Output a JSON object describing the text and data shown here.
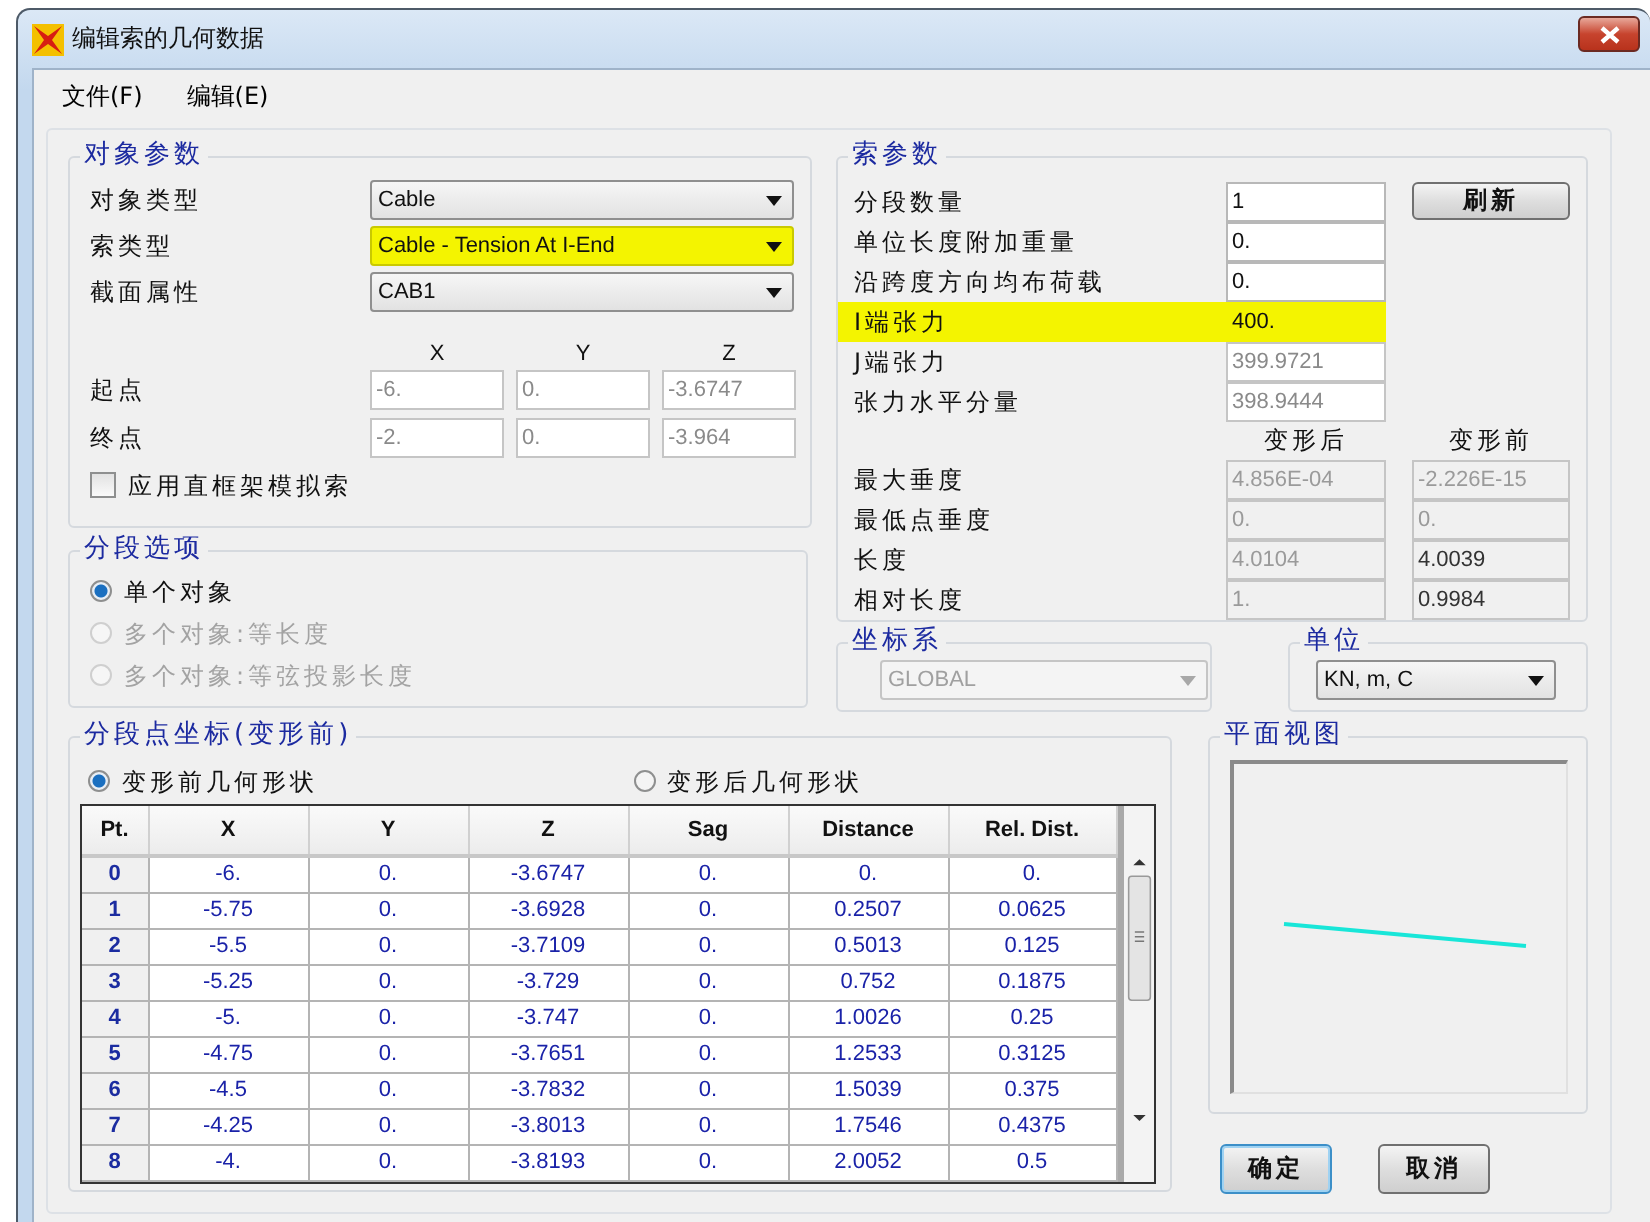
{
  "window": {
    "title": "编辑索的几何数据"
  },
  "menu": [
    {
      "label": "文件(F)"
    },
    {
      "label": "编辑(E)"
    }
  ],
  "object_params": {
    "title": "对象参数",
    "selects": [
      {
        "label": "对象类型",
        "value": "Cable",
        "highlighted": false
      },
      {
        "label": "索类型",
        "value": "Cable - Tension At I-End",
        "highlighted": true
      },
      {
        "label": "截面属性",
        "value": "CAB1",
        "highlighted": false
      }
    ],
    "axes": [
      "X",
      "Y",
      "Z"
    ],
    "points": [
      {
        "label": "起点",
        "values": [
          "-6.",
          "0.",
          "-3.6747"
        ]
      },
      {
        "label": "终点",
        "values": [
          "-2.",
          "0.",
          "-3.964"
        ]
      }
    ],
    "checkbox": {
      "label": "应用直框架模拟索",
      "checked": false
    }
  },
  "segment_options": {
    "title": "分段选项",
    "options": [
      {
        "label": "单个对象",
        "selected": true,
        "disabled": false
      },
      {
        "label": "多个对象:等长度",
        "selected": false,
        "disabled": true
      },
      {
        "label": "多个对象:等弦投影长度",
        "selected": false,
        "disabled": true
      }
    ]
  },
  "segment_points": {
    "title": "分段点坐标(变形前)",
    "shapes": [
      {
        "label": "变形前几何形状",
        "selected": true
      },
      {
        "label": "变形后几何形状",
        "selected": false
      }
    ],
    "columns": [
      "Pt.",
      "X",
      "Y",
      "Z",
      "Sag",
      "Distance",
      "Rel. Dist."
    ],
    "rows": [
      [
        "0",
        "-6.",
        "0.",
        "-3.6747",
        "0.",
        "0.",
        "0."
      ],
      [
        "1",
        "-5.75",
        "0.",
        "-3.6928",
        "0.",
        "0.2507",
        "0.0625"
      ],
      [
        "2",
        "-5.5",
        "0.",
        "-3.7109",
        "0.",
        "0.5013",
        "0.125"
      ],
      [
        "3",
        "-5.25",
        "0.",
        "-3.729",
        "0.",
        "0.752",
        "0.1875"
      ],
      [
        "4",
        "-5.",
        "0.",
        "-3.747",
        "0.",
        "1.0026",
        "0.25"
      ],
      [
        "5",
        "-4.75",
        "0.",
        "-3.7651",
        "0.",
        "1.2533",
        "0.3125"
      ],
      [
        "6",
        "-4.5",
        "0.",
        "-3.7832",
        "0.",
        "1.5039",
        "0.375"
      ],
      [
        "7",
        "-4.25",
        "0.",
        "-3.8013",
        "0.",
        "1.7546",
        "0.4375"
      ],
      [
        "8",
        "-4.",
        "0.",
        "-3.8193",
        "0.",
        "2.0052",
        "0.5"
      ]
    ]
  },
  "cable_params": {
    "title": "索参数",
    "refresh_button": "刷新",
    "fields": [
      {
        "label": "分段数量",
        "value": "1",
        "disabled": false,
        "highlighted": false
      },
      {
        "label": "单位长度附加重量",
        "value": "0.",
        "disabled": false,
        "highlighted": false
      },
      {
        "label": "沿跨度方向均布荷载",
        "value": "0.",
        "disabled": false,
        "highlighted": false
      },
      {
        "label": "I端张力",
        "value": "400.",
        "disabled": false,
        "highlighted": true
      },
      {
        "label": "J端张力",
        "value": "399.9721",
        "disabled": true,
        "highlighted": false
      },
      {
        "label": "张力水平分量",
        "value": "398.9444",
        "disabled": true,
        "highlighted": false
      }
    ],
    "shape_columns": [
      "变形后",
      "变形前"
    ],
    "shape_rows": [
      {
        "label": "最大垂度",
        "values": [
          {
            "value": "4.856E-04",
            "disabled": true
          },
          {
            "value": "-2.226E-15",
            "disabled": true
          }
        ]
      },
      {
        "label": "最低点垂度",
        "values": [
          {
            "value": "0.",
            "disabled": true
          },
          {
            "value": "0.",
            "disabled": true
          }
        ]
      },
      {
        "label": "长度",
        "values": [
          {
            "value": "4.0104",
            "disabled": true
          },
          {
            "value": "4.0039",
            "disabled": false
          }
        ]
      },
      {
        "label": "相对长度",
        "values": [
          {
            "value": "1.",
            "disabled": true
          },
          {
            "value": "0.9984",
            "disabled": false
          }
        ]
      }
    ]
  },
  "coord_system": {
    "title": "坐标系",
    "value": "GLOBAL",
    "disabled": true
  },
  "units": {
    "title": "单位",
    "value": "KN, m, C",
    "disabled": false
  },
  "plan_view": {
    "title": "平面视图"
  },
  "buttons": [
    {
      "label": "确定",
      "default": true
    },
    {
      "label": "取消",
      "default": false
    }
  ]
}
